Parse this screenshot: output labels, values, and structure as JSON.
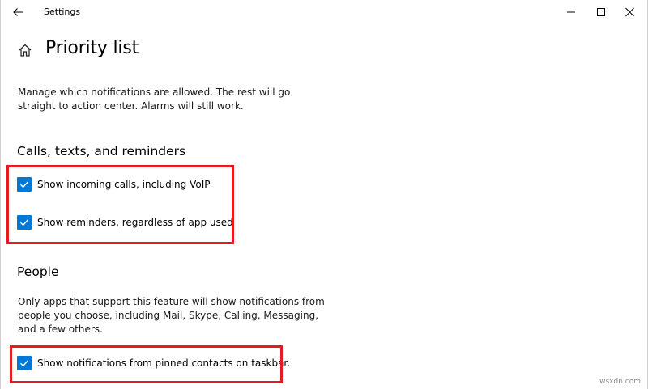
{
  "window": {
    "title": "Settings"
  },
  "page": {
    "title": "Priority list",
    "description": "Manage which notifications are allowed. The rest will go straight to action center. Alarms will still work."
  },
  "sections": {
    "calls": {
      "heading": "Calls, texts, and reminders",
      "items": [
        {
          "label": "Show incoming calls, including VoIP",
          "checked": true
        },
        {
          "label": "Show reminders, regardless of app used",
          "checked": true
        }
      ]
    },
    "people": {
      "heading": "People",
      "description": "Only apps that support this feature will show notifications from people you choose, including Mail, Skype, Calling, Messaging, and a few others.",
      "items": [
        {
          "label": "Show notifications from pinned contacts on taskbar.",
          "checked": true
        }
      ]
    }
  },
  "watermark": "wsxdn.com",
  "colors": {
    "accent": "#0078d7",
    "highlight": "#e51b24"
  },
  "icons": {
    "back": "back-arrow-icon",
    "home": "home-icon",
    "minimize": "minimize-icon",
    "maximize": "maximize-icon",
    "close": "close-icon",
    "checkmark": "checkmark-icon"
  }
}
